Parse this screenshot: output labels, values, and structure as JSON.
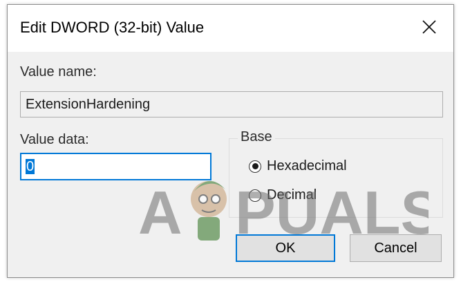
{
  "window": {
    "title": "Edit DWORD (32-bit) Value",
    "close_glyph": "✕"
  },
  "value_name": {
    "label": "Value name:",
    "value": "ExtensionHardening"
  },
  "value_data": {
    "label": "Value data:",
    "value": "0"
  },
  "base": {
    "legend": "Base",
    "options": [
      {
        "label": "Hexadecimal",
        "selected": true
      },
      {
        "label": "Decimal",
        "selected": false
      }
    ]
  },
  "buttons": {
    "ok": "OK",
    "cancel": "Cancel"
  },
  "watermark": {
    "text": "APPUALS"
  },
  "colors": {
    "accent": "#0078d7",
    "dialog_bg": "#f0f0f0",
    "watermark": "#6e6e6e"
  }
}
